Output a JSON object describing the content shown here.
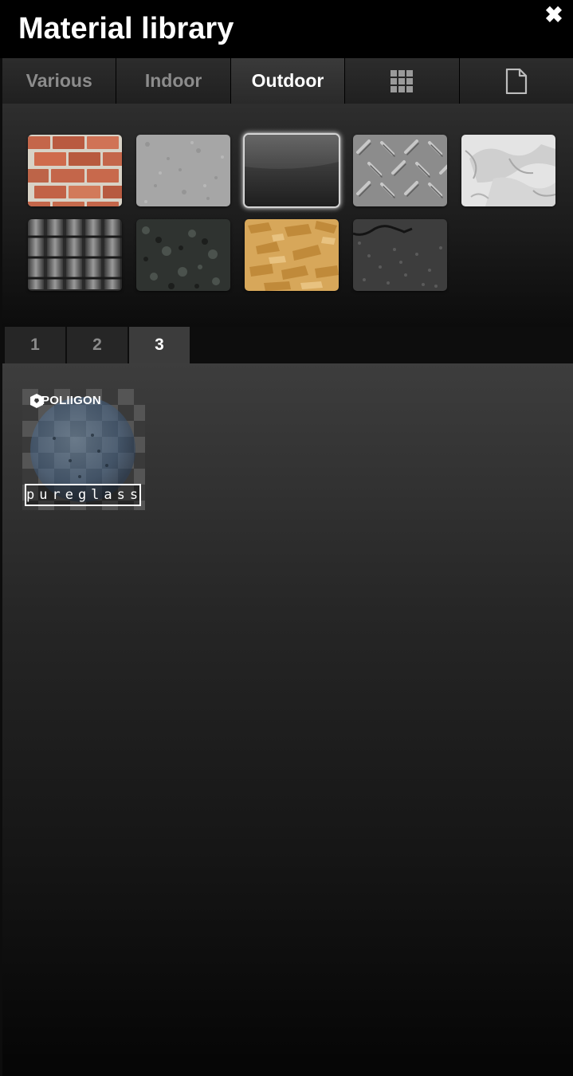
{
  "header": {
    "title": "Material library",
    "close_icon": "close-icon"
  },
  "category_tabs": [
    {
      "label": "Various",
      "active": false
    },
    {
      "label": "Indoor",
      "active": false
    },
    {
      "label": "Outdoor",
      "active": true
    },
    {
      "icon": "grid-icon",
      "active": false
    },
    {
      "icon": "document-icon",
      "active": false
    }
  ],
  "materials": [
    {
      "name": "brick",
      "selected": false
    },
    {
      "name": "concrete",
      "selected": false
    },
    {
      "name": "dark-glass",
      "selected": true
    },
    {
      "name": "diamond-plate-metal",
      "selected": false
    },
    {
      "name": "white-plaster",
      "selected": false
    },
    {
      "name": "roof-tiles",
      "selected": false
    },
    {
      "name": "dark-granite",
      "selected": false
    },
    {
      "name": "osb-wood",
      "selected": false
    },
    {
      "name": "asphalt",
      "selected": false
    }
  ],
  "page_tabs": [
    {
      "label": "1",
      "active": false
    },
    {
      "label": "2",
      "active": false
    },
    {
      "label": "3",
      "active": true
    }
  ],
  "items": [
    {
      "brand": "POLIIGON",
      "name": "pureglass"
    }
  ],
  "colors": {
    "background": "#0d0d0d",
    "tab_active_text": "#ffffff",
    "tab_inactive_text": "#8c8c8c"
  }
}
